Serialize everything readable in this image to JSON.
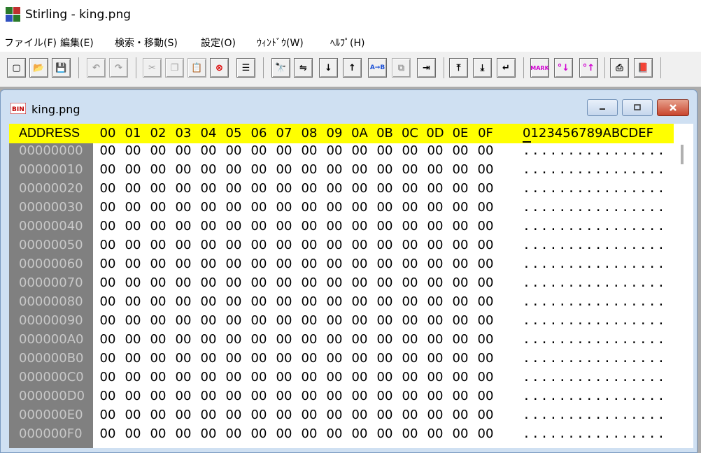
{
  "window": {
    "title": "Stirling - king.png"
  },
  "menu": [
    "ファイル(F)",
    "編集(E)",
    "検索・移動(S)",
    "設定(O)",
    "ｳｨﾝﾄﾞｳ(W)",
    "ﾍﾙﾌﾟ(H)"
  ],
  "toolbar": {
    "icons": [
      "new-icon",
      "open-icon",
      "save-icon",
      "undo-icon",
      "redo-icon",
      "cut-icon",
      "copy-icon",
      "paste-icon",
      "delete-icon",
      "list-icon",
      "find-icon",
      "find-replace-icon",
      "find-next-icon",
      "find-prev-icon",
      "find-ab-icon",
      "compare-icon",
      "goto-icon",
      "jump-top-icon",
      "jump-bottom-icon",
      "jump-to-icon",
      "mark-icon",
      "mark-next-icon",
      "mark-prev-icon",
      "print-icon",
      "help-book-icon"
    ],
    "mark_label": "MARK"
  },
  "document": {
    "title": "king.png",
    "header": {
      "address_label": "ADDRESS",
      "columns": [
        "00",
        "01",
        "02",
        "03",
        "04",
        "05",
        "06",
        "07",
        "08",
        "09",
        "0A",
        "0B",
        "0C",
        "0D",
        "0E",
        "0F"
      ],
      "ascii_label": "0123456789ABCDEF"
    },
    "rows": [
      {
        "addr": "00000000",
        "bytes": [
          "00",
          "00",
          "00",
          "00",
          "00",
          "00",
          "00",
          "00",
          "00",
          "00",
          "00",
          "00",
          "00",
          "00",
          "00",
          "00"
        ],
        "ascii": "................"
      },
      {
        "addr": "00000010",
        "bytes": [
          "00",
          "00",
          "00",
          "00",
          "00",
          "00",
          "00",
          "00",
          "00",
          "00",
          "00",
          "00",
          "00",
          "00",
          "00",
          "00"
        ],
        "ascii": "................"
      },
      {
        "addr": "00000020",
        "bytes": [
          "00",
          "00",
          "00",
          "00",
          "00",
          "00",
          "00",
          "00",
          "00",
          "00",
          "00",
          "00",
          "00",
          "00",
          "00",
          "00"
        ],
        "ascii": "................"
      },
      {
        "addr": "00000030",
        "bytes": [
          "00",
          "00",
          "00",
          "00",
          "00",
          "00",
          "00",
          "00",
          "00",
          "00",
          "00",
          "00",
          "00",
          "00",
          "00",
          "00"
        ],
        "ascii": "................"
      },
      {
        "addr": "00000040",
        "bytes": [
          "00",
          "00",
          "00",
          "00",
          "00",
          "00",
          "00",
          "00",
          "00",
          "00",
          "00",
          "00",
          "00",
          "00",
          "00",
          "00"
        ],
        "ascii": "................"
      },
      {
        "addr": "00000050",
        "bytes": [
          "00",
          "00",
          "00",
          "00",
          "00",
          "00",
          "00",
          "00",
          "00",
          "00",
          "00",
          "00",
          "00",
          "00",
          "00",
          "00"
        ],
        "ascii": "................"
      },
      {
        "addr": "00000060",
        "bytes": [
          "00",
          "00",
          "00",
          "00",
          "00",
          "00",
          "00",
          "00",
          "00",
          "00",
          "00",
          "00",
          "00",
          "00",
          "00",
          "00"
        ],
        "ascii": "................"
      },
      {
        "addr": "00000070",
        "bytes": [
          "00",
          "00",
          "00",
          "00",
          "00",
          "00",
          "00",
          "00",
          "00",
          "00",
          "00",
          "00",
          "00",
          "00",
          "00",
          "00"
        ],
        "ascii": "................"
      },
      {
        "addr": "00000080",
        "bytes": [
          "00",
          "00",
          "00",
          "00",
          "00",
          "00",
          "00",
          "00",
          "00",
          "00",
          "00",
          "00",
          "00",
          "00",
          "00",
          "00"
        ],
        "ascii": "................"
      },
      {
        "addr": "00000090",
        "bytes": [
          "00",
          "00",
          "00",
          "00",
          "00",
          "00",
          "00",
          "00",
          "00",
          "00",
          "00",
          "00",
          "00",
          "00",
          "00",
          "00"
        ],
        "ascii": "................"
      },
      {
        "addr": "000000A0",
        "bytes": [
          "00",
          "00",
          "00",
          "00",
          "00",
          "00",
          "00",
          "00",
          "00",
          "00",
          "00",
          "00",
          "00",
          "00",
          "00",
          "00"
        ],
        "ascii": "................"
      },
      {
        "addr": "000000B0",
        "bytes": [
          "00",
          "00",
          "00",
          "00",
          "00",
          "00",
          "00",
          "00",
          "00",
          "00",
          "00",
          "00",
          "00",
          "00",
          "00",
          "00"
        ],
        "ascii": "................"
      },
      {
        "addr": "000000C0",
        "bytes": [
          "00",
          "00",
          "00",
          "00",
          "00",
          "00",
          "00",
          "00",
          "00",
          "00",
          "00",
          "00",
          "00",
          "00",
          "00",
          "00"
        ],
        "ascii": "................"
      },
      {
        "addr": "000000D0",
        "bytes": [
          "00",
          "00",
          "00",
          "00",
          "00",
          "00",
          "00",
          "00",
          "00",
          "00",
          "00",
          "00",
          "00",
          "00",
          "00",
          "00"
        ],
        "ascii": "................"
      },
      {
        "addr": "000000E0",
        "bytes": [
          "00",
          "00",
          "00",
          "00",
          "00",
          "00",
          "00",
          "00",
          "00",
          "00",
          "00",
          "00",
          "00",
          "00",
          "00",
          "00"
        ],
        "ascii": "................"
      },
      {
        "addr": "000000F0",
        "bytes": [
          "00",
          "00",
          "00",
          "00",
          "00",
          "00",
          "00",
          "00",
          "00",
          "00",
          "00",
          "00",
          "00",
          "00",
          "00",
          "00"
        ],
        "ascii": "................"
      }
    ]
  },
  "colors": {
    "header_bg": "#ffff00",
    "address_bg": "#808080",
    "address_text": "#c8c8c8",
    "close_button": "#c9452d"
  }
}
